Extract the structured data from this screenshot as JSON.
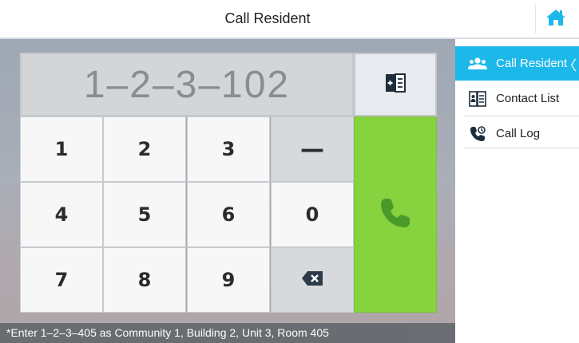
{
  "header": {
    "title": "Call Resident"
  },
  "display": {
    "value": "1–2–3–102"
  },
  "keypad": {
    "keys": [
      {
        "label": "1"
      },
      {
        "label": "2"
      },
      {
        "label": "3"
      },
      {
        "label": "—"
      },
      {
        "label": "4"
      },
      {
        "label": "5"
      },
      {
        "label": "6"
      },
      {
        "label": "0"
      },
      {
        "label": "7"
      },
      {
        "label": "8"
      },
      {
        "label": "9"
      },
      {
        "label": "backspace",
        "icon": "backspace-icon"
      }
    ]
  },
  "hint": {
    "text": "*Enter 1–2–3–405 as Community 1, Building 2, Unit 3, Room 405"
  },
  "sidebar": {
    "items": [
      {
        "label": "Call Resident",
        "icon": "users-icon",
        "active": true,
        "indicator": "〈"
      },
      {
        "label": "Contact List",
        "icon": "contact-book-icon",
        "active": false
      },
      {
        "label": "Call Log",
        "icon": "call-log-icon",
        "active": false
      }
    ]
  },
  "colors": {
    "accent": "#1db8ea",
    "call_button": "#86d23f",
    "call_icon": "#4a9a2a",
    "home_icon": "#1db8ea"
  }
}
